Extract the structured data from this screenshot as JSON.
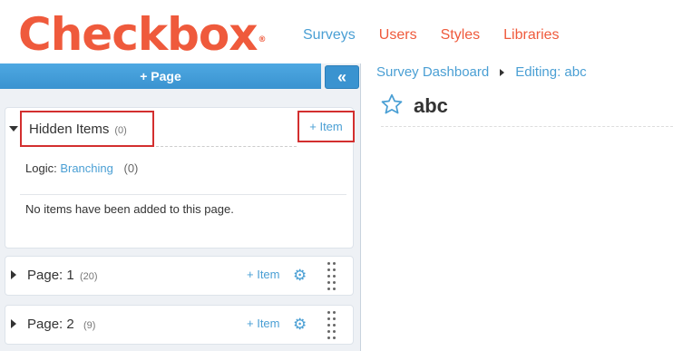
{
  "header": {
    "logo_text": "Checkbox",
    "logo_mark": "®",
    "nav": [
      "Surveys",
      "Users",
      "Styles",
      "Libraries"
    ]
  },
  "left_panel": {
    "add_page_label": "+ Page",
    "collapse_glyph": "«",
    "hidden_items": {
      "title": "Hidden Items",
      "count": "(0)",
      "add_item_label": "+ Item",
      "logic_label": "Logic:",
      "logic_link": "Branching",
      "logic_count": "(0)",
      "empty_message": "No items have been added to this page."
    },
    "pages": [
      {
        "title": "Page: 1",
        "count": "(20)",
        "add_item_label": "+ Item"
      },
      {
        "title": "Page: 2",
        "count": "(9)",
        "add_item_label": "+ Item"
      }
    ]
  },
  "main": {
    "breadcrumb": [
      "Survey Dashboard",
      "Editing: abc"
    ],
    "survey_title": "abc"
  },
  "colors": {
    "brand": "#ef5a3c",
    "link": "#4a9fd4",
    "highlight": "#d32f2f"
  },
  "icons": [
    "star-icon",
    "gear-icon",
    "drag-handle-icon",
    "caret-down-icon",
    "caret-right-icon",
    "collapse-icon"
  ]
}
